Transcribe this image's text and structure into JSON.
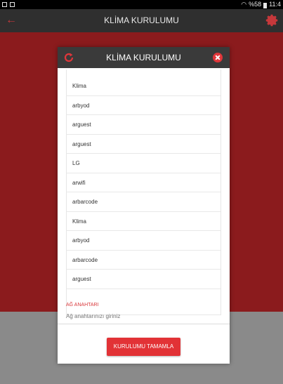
{
  "statusbar": {
    "battery": "%58",
    "time": "11:4"
  },
  "appbar": {
    "title": "KLİMA KURULUMU"
  },
  "dialog": {
    "title": "KLİMA KURULUMU",
    "partial_item": "arbarcode",
    "items": [
      "Klima",
      "arbyod",
      "arguest",
      "arguest",
      "LG",
      "arwifi",
      "arbarcode",
      "Klima",
      "arbyod",
      "arbarcode",
      "arguest"
    ],
    "field_label": "AĞ ANAHTARI",
    "field_placeholder": "Ağ anahtarınızı giriniz",
    "button_label": "KURULUMU TAMAMLA"
  },
  "colors": {
    "accent": "#e23236",
    "app_bg": "#8b1b1d",
    "header": "#2f2f2f"
  }
}
